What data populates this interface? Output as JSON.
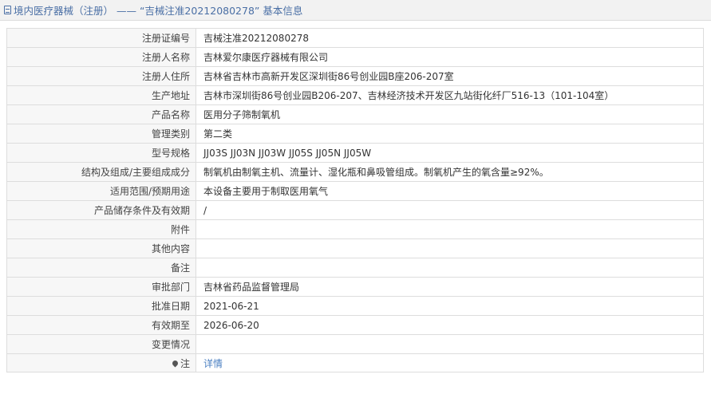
{
  "header": {
    "title": "境内医疗器械（注册） —— “吉械注准20212080278” 基本信息",
    "icon": "document-icon"
  },
  "rows": [
    {
      "label": "注册证编号",
      "value": "吉械注准20212080278"
    },
    {
      "label": "注册人名称",
      "value": "吉林爱尔康医疗器械有限公司"
    },
    {
      "label": "注册人住所",
      "value": "吉林省吉林市高新开发区深圳街86号创业园B座206-207室"
    },
    {
      "label": "生产地址",
      "value": "吉林市深圳街86号创业园B206-207、吉林经济技术开发区九站街化纤厂516-13（101-104室）"
    },
    {
      "label": "产品名称",
      "value": "医用分子筛制氧机"
    },
    {
      "label": "管理类别",
      "value": "第二类"
    },
    {
      "label": "型号规格",
      "value": "JJ03S JJ03N JJ03W JJ05S JJ05N JJ05W"
    },
    {
      "label": "结构及组成/主要组成成分",
      "value": "制氧机由制氧主机、流量计、湿化瓶和鼻吸管组成。制氧机产生的氧含量≥92%。"
    },
    {
      "label": "适用范围/预期用途",
      "value": "本设备主要用于制取医用氧气"
    },
    {
      "label": "产品储存条件及有效期",
      "value": "/"
    },
    {
      "label": "附件",
      "value": ""
    },
    {
      "label": "其他内容",
      "value": ""
    },
    {
      "label": "备注",
      "value": ""
    },
    {
      "label": "审批部门",
      "value": "吉林省药品监督管理局"
    },
    {
      "label": "批准日期",
      "value": "2021-06-21"
    },
    {
      "label": "有效期至",
      "value": "2026-06-20"
    },
    {
      "label": "变更情况",
      "value": ""
    }
  ],
  "note": {
    "label": "注",
    "icon": "pin-icon",
    "link_text": "详情"
  },
  "colors": {
    "header_text": "#4a6fa5",
    "link": "#4a7fc1",
    "border": "#dddddd",
    "label_bg": "#f7f7f7"
  }
}
